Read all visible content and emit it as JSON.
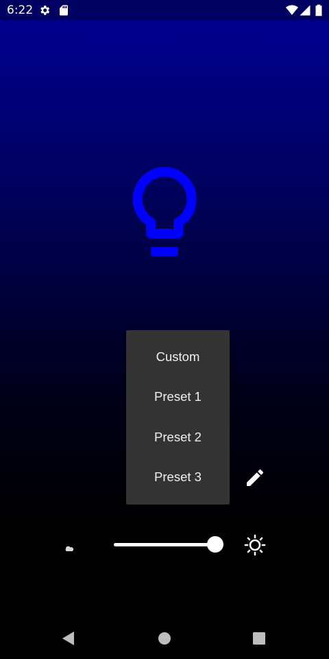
{
  "status_bar": {
    "time": "6:22",
    "left_icons": [
      "settings-icon",
      "sd-card-icon"
    ],
    "right_icons": [
      "wifi-icon",
      "signal-icon",
      "battery-icon"
    ]
  },
  "light": {
    "icon": "lightbulb-icon",
    "color": "#0000ff"
  },
  "preset_menu": {
    "items": [
      "Custom",
      "Preset 1",
      "Preset 2",
      "Preset 3"
    ]
  },
  "controls": {
    "edit_icon": "pencil-icon",
    "dim_icon": "moon-icon",
    "bright_icon": "sun-icon",
    "brightness": 1.0
  },
  "nav_bar": {
    "icons": [
      "back-icon",
      "home-icon",
      "recents-icon"
    ]
  }
}
